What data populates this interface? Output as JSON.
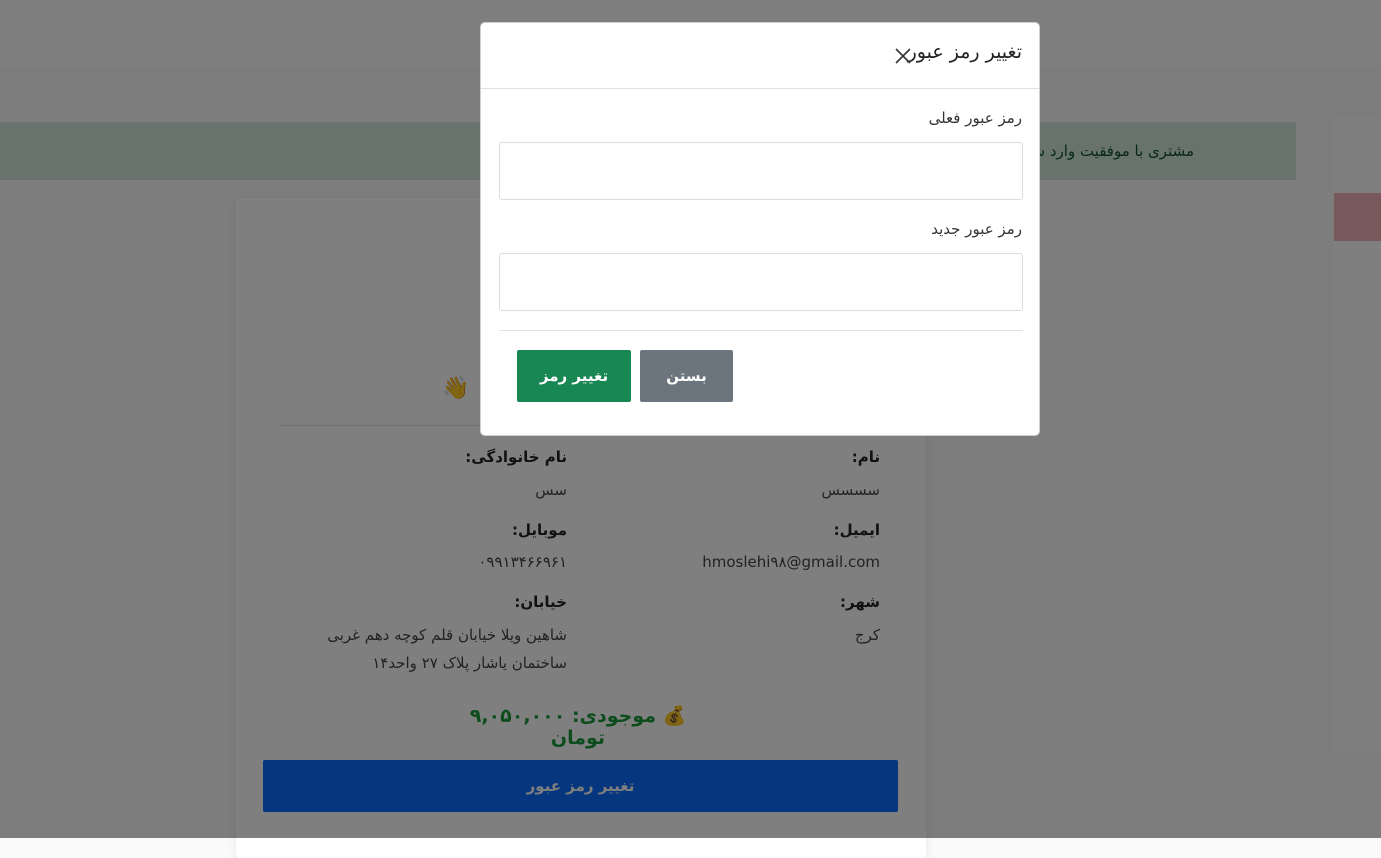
{
  "alert": {
    "message": "مشتری با موفقیت وارد شد"
  },
  "profile": {
    "fields": {
      "first_name": {
        "label": "نام:",
        "value": "سسسس"
      },
      "last_name": {
        "label": "نام خانوادگی:",
        "value": "سس"
      },
      "email": {
        "label": "ایمیل:",
        "value": "hmoslehi۹۸@gmail.com"
      },
      "mobile": {
        "label": "موبایل:",
        "value": "۰۹۹۱۳۴۶۶۹۶۱"
      },
      "city": {
        "label": "شهر:",
        "value": "کرج"
      },
      "street": {
        "label": "خیابان:",
        "value_line1": "شاهین ویلا خیابان قلم کوچه دهم غربی",
        "value_line2": "ساختمان یاشار پلاک ۲۷ واحد۱۴"
      }
    },
    "balance": "💰 موجودی: ۹,۰۵۰,۰۰۰ تومان",
    "wave_emoji": "👋",
    "change_password_button": "تغییر رمز عبور"
  },
  "modal": {
    "title": "تغییر رمز عبور",
    "current_password_label": "رمز عبور فعلی",
    "new_password_label": "رمز عبور جدید",
    "close_button": "بستن",
    "submit_button": "تغییر رمز"
  },
  "colors": {
    "success_text": "#0f5132",
    "success_bg": "#d1e7dd",
    "primary": "#0d6efd",
    "success_button": "#198754",
    "secondary_button": "#6c757d",
    "balance_text": "#1a9a3a"
  },
  "icons": {
    "close": "close-icon",
    "wave": "wave-emoji",
    "money_bag": "money-bag-emoji"
  }
}
